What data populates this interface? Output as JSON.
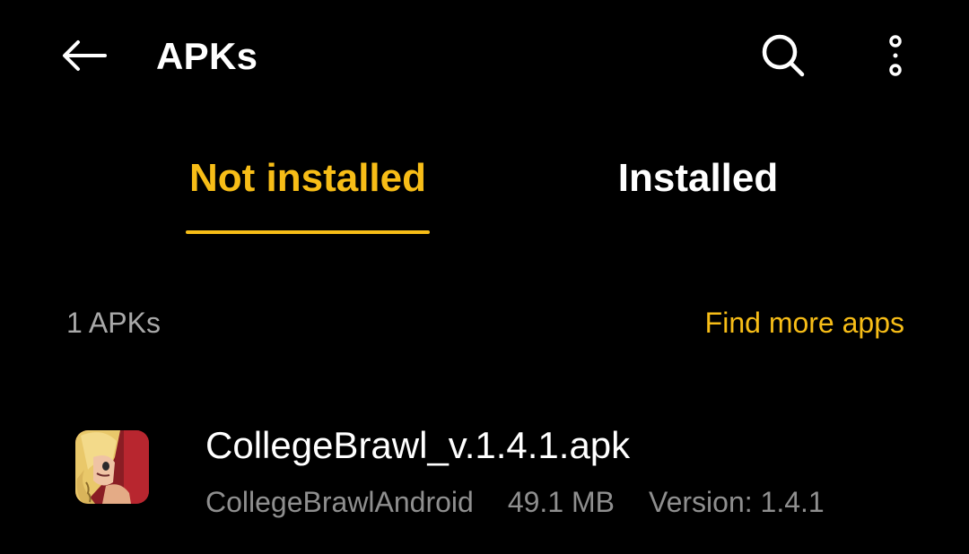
{
  "appbar": {
    "title": "APKs",
    "back_icon": "arrow-left-icon",
    "search_icon": "search-icon",
    "more_icon": "more-vertical-icon"
  },
  "tabs": [
    {
      "label": "Not installed",
      "selected": true
    },
    {
      "label": "Installed",
      "selected": false
    }
  ],
  "list_header": {
    "count": "1 APKs",
    "find_more": "Find more apps"
  },
  "apks": [
    {
      "file_name": "CollegeBrawl_v.1.4.1.apk",
      "package": "CollegeBrawlAndroid",
      "size": "49.1 MB",
      "version": "Version: 1.4.1",
      "icon": "app-icon-collegebrawl"
    }
  ],
  "colors": {
    "background": "#000000",
    "accent": "#f7bd17",
    "primary_text": "#ffffff",
    "secondary_text": "#8f8f8f"
  }
}
